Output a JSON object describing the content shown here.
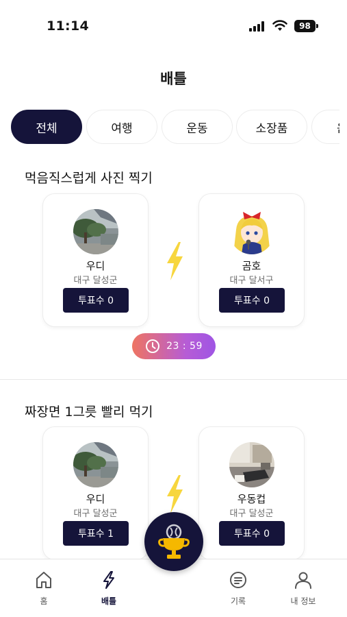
{
  "status_bar": {
    "time": "11:14",
    "battery": "98"
  },
  "header": {
    "title": "배틀"
  },
  "categories": [
    {
      "label": "전체",
      "active": true
    },
    {
      "label": "여행",
      "active": false
    },
    {
      "label": "운동",
      "active": false
    },
    {
      "label": "소장품",
      "active": false
    },
    {
      "label": "음",
      "active": false
    }
  ],
  "battles": [
    {
      "title": "먹음직스럽게 사진 찍기",
      "left": {
        "name": "우디",
        "location": "대구 달성군",
        "votes_label": "투표수 0",
        "avatar": "outdoor-tree-photo"
      },
      "right": {
        "name": "곰호",
        "location": "대구 달서구",
        "votes_label": "투표수 0",
        "avatar": "anime-girl-with-microphone"
      },
      "timer": "23 : 59"
    },
    {
      "title": "짜장면 1그릇 빨리 먹기",
      "left": {
        "name": "우디",
        "location": "대구 달성군",
        "votes_label": "투표수 1",
        "avatar": "outdoor-tree-photo"
      },
      "right": {
        "name": "우동컵",
        "location": "대구 달성군",
        "votes_label": "투표수 0",
        "avatar": "desk-laptop-photo"
      }
    }
  ],
  "nav": {
    "home": "홈",
    "battle": "배틀",
    "record": "기록",
    "profile": "내 정보",
    "active": "battle"
  },
  "colors": {
    "primary": "#15143a",
    "bolt": "#f7d63e",
    "timer_start": "#ee7462",
    "timer_end": "#9f55e4"
  }
}
